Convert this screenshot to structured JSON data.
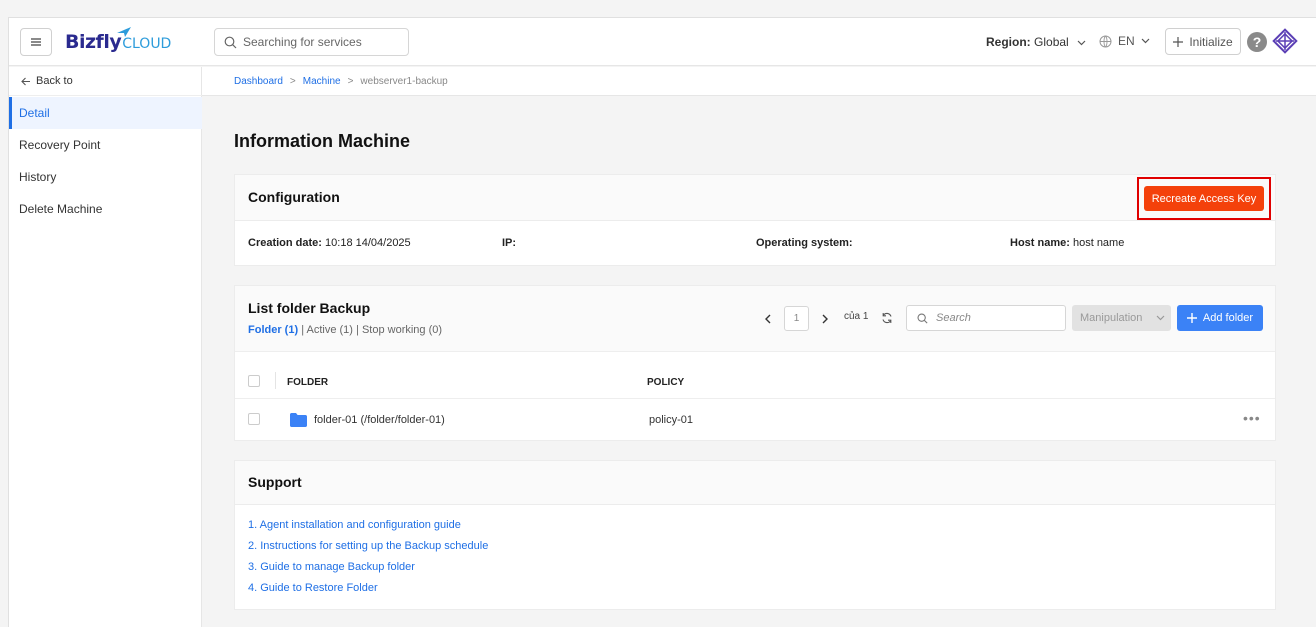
{
  "header": {
    "search_placeholder": "Searching for services",
    "logo_main": "Bizfly",
    "logo_sub": "CLOUD",
    "region_label": "Region:",
    "region_value": "Global",
    "language": "EN",
    "initialize_label": "Initialize",
    "help_label": "?"
  },
  "sidebar": {
    "back_label": "Back to",
    "items": [
      {
        "label": "Detail",
        "active": true
      },
      {
        "label": "Recovery Point",
        "active": false
      },
      {
        "label": "History",
        "active": false
      },
      {
        "label": "Delete Machine",
        "active": false
      }
    ]
  },
  "breadcrumb": {
    "items": [
      "Dashboard",
      "Machine",
      "webserver1-backup"
    ],
    "separator": ">"
  },
  "page": {
    "title": "Information Machine"
  },
  "configuration": {
    "title": "Configuration",
    "recreate_label": "Recreate Access Key",
    "creation_date_label": "Creation date:",
    "creation_date_value": "10:18 14/04/2025",
    "ip_label": "IP:",
    "ip_value": "",
    "os_label": "Operating system:",
    "os_value": "",
    "hostname_label": "Host name:",
    "hostname_value": "host name"
  },
  "folder_list": {
    "title": "List folder Backup",
    "tabs": {
      "folder": "Folder (1)",
      "active": "Active (1)",
      "stop": "Stop working (0)",
      "divider": "|"
    },
    "pager": {
      "current_page": "1",
      "of_text": "của 1"
    },
    "search_placeholder": "Search",
    "manipulation_label": "Manipulation",
    "add_label": "Add folder",
    "columns": [
      "FOLDER",
      "POLICY"
    ],
    "rows": [
      {
        "folder": "folder-01 (/folder/folder-01)",
        "policy": "policy-01"
      }
    ],
    "more_label": "•••"
  },
  "support": {
    "title": "Support",
    "links": [
      "1. Agent installation and configuration guide",
      "2. Instructions for setting up the Backup schedule",
      "3. Guide to manage Backup folder",
      "4. Guide to Restore Folder"
    ]
  },
  "colors": {
    "primary": "#1f6fe5",
    "recreate": "#f4410b",
    "highlight_border": "#e00000",
    "add_button": "#3b82f6"
  }
}
